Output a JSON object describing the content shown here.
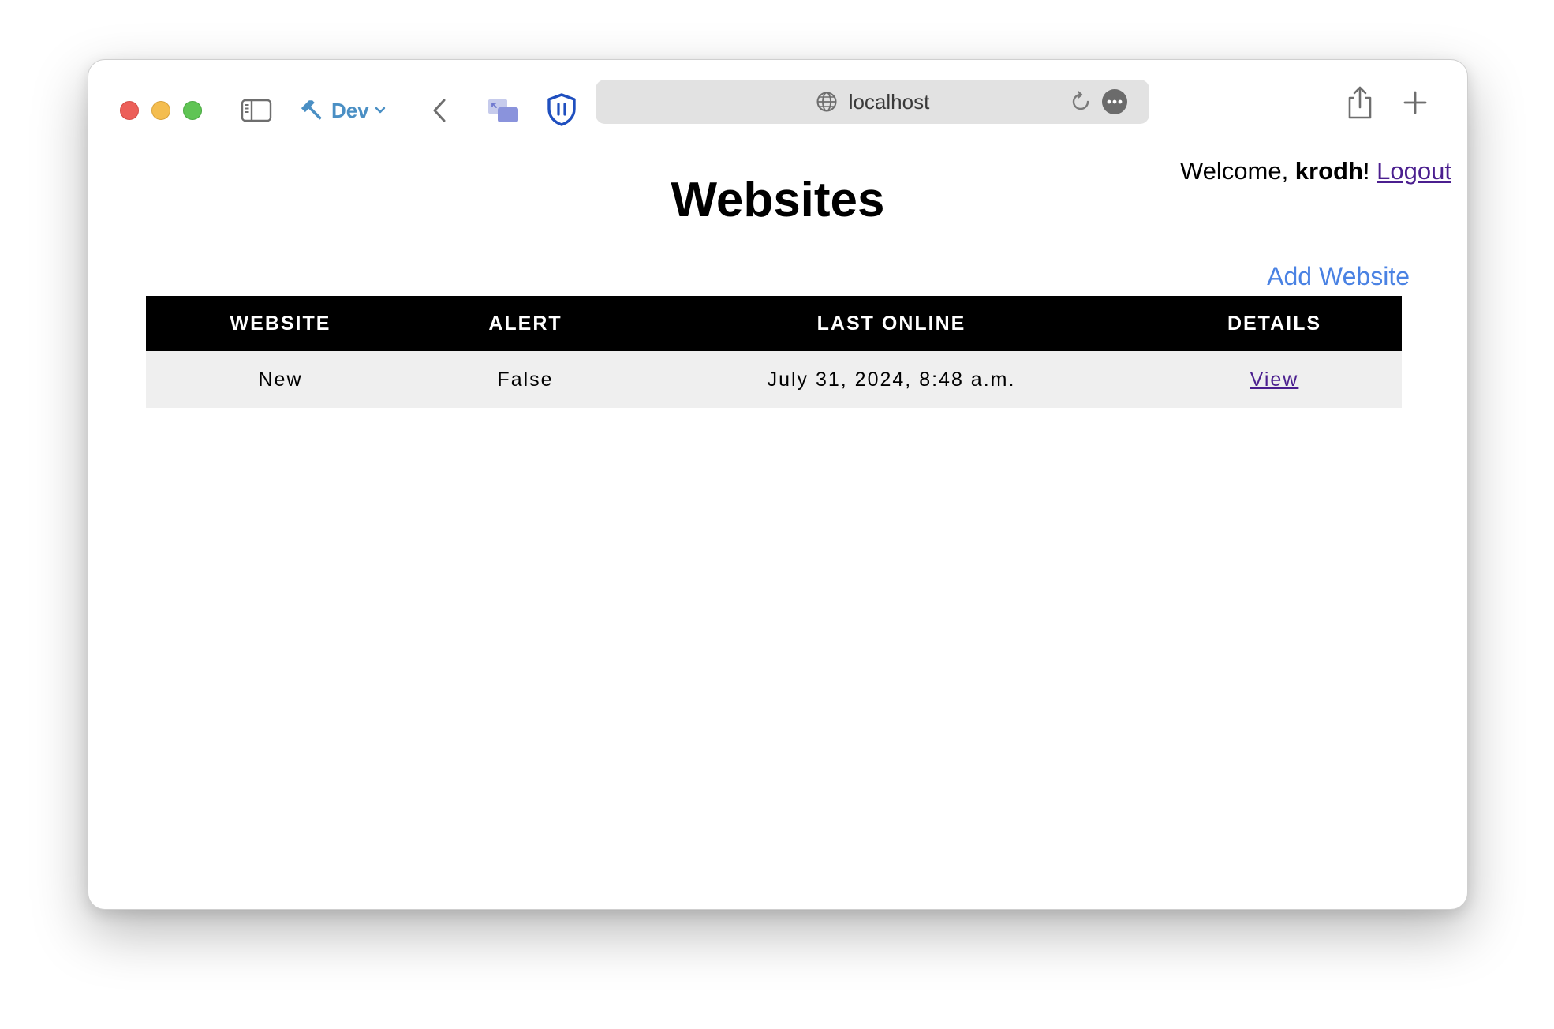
{
  "browser": {
    "dev_label": "Dev",
    "url": "localhost"
  },
  "header": {
    "welcome_prefix": "Welcome, ",
    "username": "krodh",
    "welcome_suffix": "!",
    "logout_label": "Logout"
  },
  "main": {
    "title": "Websites",
    "add_website_label": "Add Website",
    "table": {
      "headers": [
        "WEBSITE",
        "ALERT",
        "LAST ONLINE",
        "DETAILS"
      ],
      "rows": [
        {
          "website": "New",
          "alert": "False",
          "last_online": "July 31, 2024, 8:48 a.m.",
          "details_label": "View"
        }
      ]
    }
  },
  "colors": {
    "link_visited": "#4b1f8f",
    "link_accent": "#4a82e3",
    "table_header_bg": "#000000",
    "table_row_bg": "#efefef",
    "dev_accent": "#4a8fc4"
  }
}
